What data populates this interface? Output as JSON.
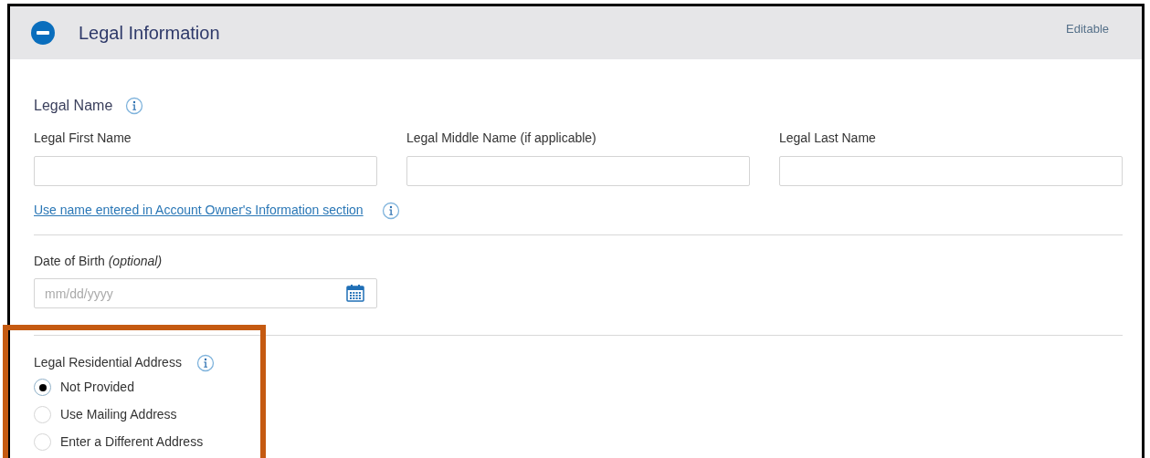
{
  "section": {
    "title": "Legal Information",
    "expanded": true,
    "status": "Editable"
  },
  "legal_name": {
    "heading": "Legal Name",
    "fields": [
      {
        "label": "Legal First Name"
      },
      {
        "label": "Legal Middle Name (if applicable)"
      },
      {
        "label": "Legal Last Name"
      }
    ],
    "link": "Use name entered in Account Owner's Information section"
  },
  "date_of_birth": {
    "label": "Date of Birth *(optional)*",
    "placeholder": "mm/dd/yyyy"
  },
  "residential_address": {
    "heading": "Legal Residential Address",
    "options": [
      {
        "label": "Not Provided",
        "selected": true
      },
      {
        "label": "Use Mailing Address",
        "selected": false
      },
      {
        "label": "Enter a Different Address",
        "selected": false
      }
    ]
  }
}
